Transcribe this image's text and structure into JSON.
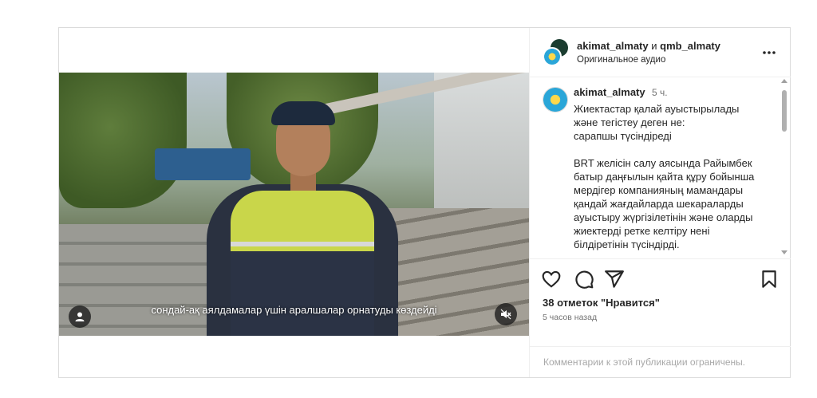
{
  "video": {
    "subtitle": "сондай-ақ аялдамалар үшін аралшалар орнатуды көздейді",
    "user_icon": "user-icon",
    "mute_icon": "speaker-muted-icon"
  },
  "header": {
    "author1": "akimat_almaty",
    "separator": " и ",
    "author2": "qmb_almaty",
    "audio": "Оригинальное аудио",
    "more_icon": "more-options-icon"
  },
  "caption": {
    "username": "akimat_almaty",
    "time": "5 ч.",
    "text": "Жиектастар қалай ауыстырылады\nжәне тегістеу деген не:\nсарапшы түсіндіреді\n\nBRT желісін салу аясында Райымбек батыр даңғылын қайта құру бойынша мердігер компанияның мамандары қандай жағдайларда шекараларды ауыстыру жүргізілетінін және оларды жиектерді ретке келтіру нені білдіретінін түсіндірді."
  },
  "actions": {
    "like_icon": "heart-icon",
    "comment_icon": "comment-icon",
    "share_icon": "share-icon",
    "save_icon": "bookmark-icon",
    "likes": "38 отметок \"Нравится\"",
    "posted": "5 часов назад"
  },
  "footer": {
    "notice": "Комментарии к этой публикации ограничены."
  },
  "colors": {
    "text": "#262626",
    "secondary": "#737373",
    "border": "#dbdbdb"
  }
}
